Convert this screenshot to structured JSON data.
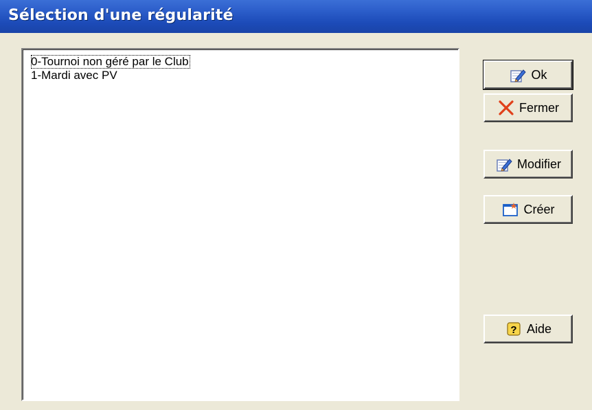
{
  "window": {
    "title": "Sélection d'une régularité"
  },
  "list": {
    "items": [
      {
        "label": "0-Tournoi non géré par le Club",
        "focused": true
      },
      {
        "label": "1-Mardi avec PV",
        "focused": false
      }
    ]
  },
  "buttons": {
    "ok": {
      "label": "Ok",
      "icon": "edit-pencil-icon"
    },
    "fermer": {
      "label": "Fermer",
      "icon": "close-x-icon"
    },
    "modifier": {
      "label": "Modifier",
      "icon": "edit-pencil-icon"
    },
    "creer": {
      "label": "Créer",
      "icon": "new-window-icon"
    },
    "aide": {
      "label": "Aide",
      "icon": "help-icon"
    }
  }
}
